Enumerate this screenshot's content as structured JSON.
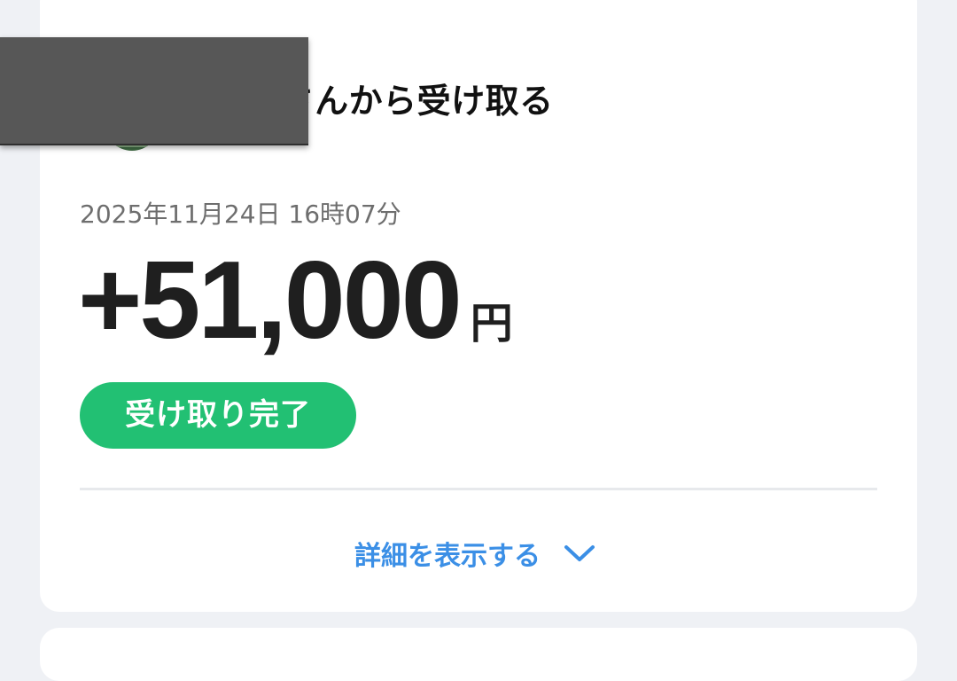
{
  "receive": {
    "title": "tさんから受け取る",
    "timestamp": "2025年11月24日 16時07分",
    "amount": "+51,000",
    "currency": "円",
    "status": "受け取り完了",
    "details_label": "詳細を表示する"
  },
  "colors": {
    "status_green": "#22c073",
    "link_blue": "#3b8fe6",
    "background": "#eff1f5"
  },
  "icons": {
    "details_toggle": "chevron-down-icon"
  }
}
